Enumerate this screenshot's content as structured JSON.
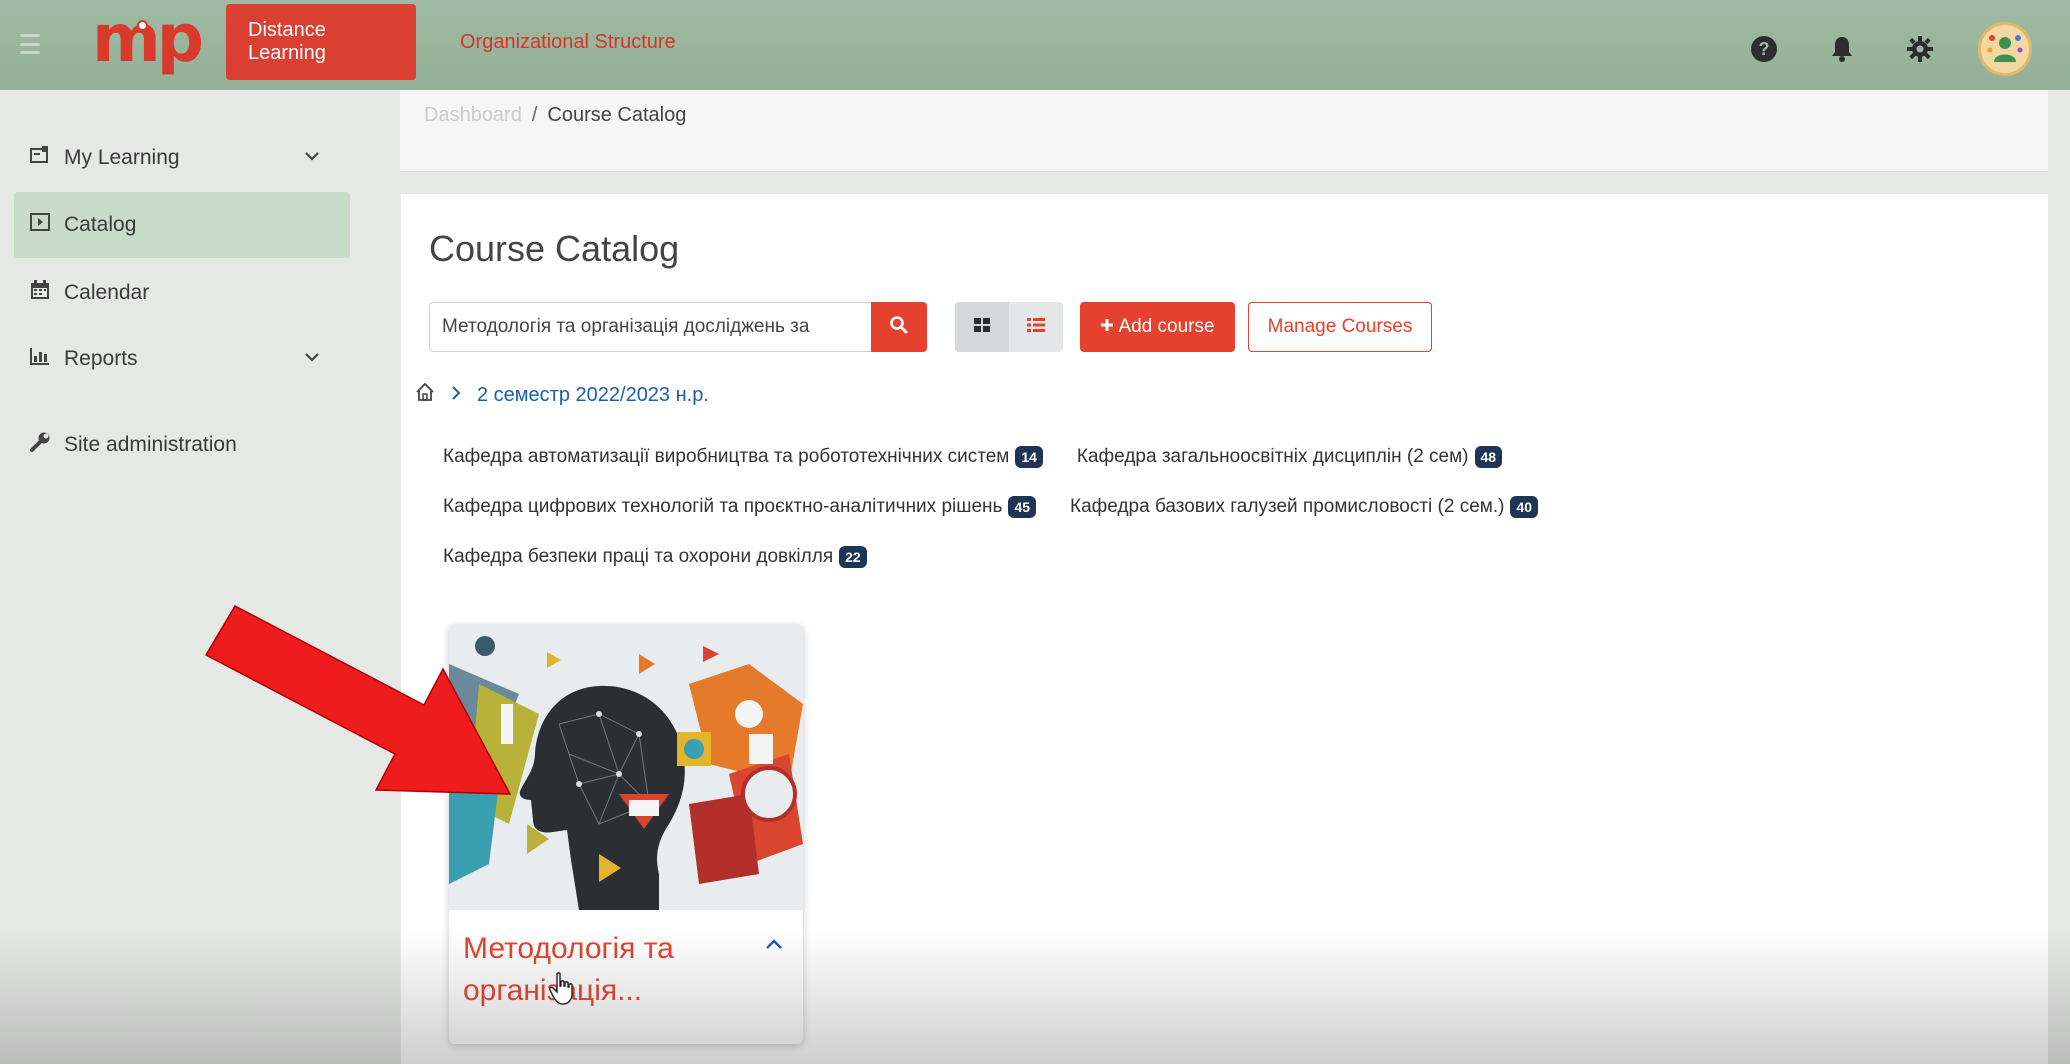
{
  "navbar": {
    "logo_text": "mp",
    "tabs": [
      {
        "label": "Distance Learning",
        "active": true
      },
      {
        "label": "Organizational Structure",
        "active": false
      }
    ],
    "icons": [
      "help-icon",
      "bell-icon",
      "gear-icon",
      "avatar"
    ]
  },
  "sidebar": {
    "items": [
      {
        "label": "My Learning",
        "icon": "my-learning-icon",
        "expandable": true
      },
      {
        "label": "Catalog",
        "icon": "catalog-icon",
        "active": true
      },
      {
        "label": "Calendar",
        "icon": "calendar-icon"
      },
      {
        "label": "Reports",
        "icon": "reports-icon",
        "expandable": true
      },
      {
        "label": "Site administration",
        "icon": "wrench-icon"
      }
    ]
  },
  "breadcrumb": {
    "home": "Dashboard",
    "separator": "/",
    "current": "Course Catalog"
  },
  "main": {
    "title": "Course Catalog",
    "search": {
      "value": "Методологія та організація досліджень за"
    },
    "add_course_label": "Add course",
    "manage_courses_label": "Manage Courses",
    "path": {
      "current": "2 семестр 2022/2023 н.р."
    },
    "categories": [
      {
        "name": "Кафедра автоматизації виробництва та робототехнічних систем",
        "count": "14"
      },
      {
        "name": "Кафедра загальноосвітніх дисциплін (2 сем)",
        "count": "48"
      },
      {
        "name": "Кафедра цифрових технологій та проєктно-аналітичних рішень",
        "count": "45"
      },
      {
        "name": "Кафедра базових галузей промисловості (2 сем.)",
        "count": "40"
      },
      {
        "name": "Кафедра безпеки праці та охорони довкілля",
        "count": "22"
      }
    ],
    "course_card": {
      "title_line1": "Методологія та",
      "title_line2": "організація..."
    }
  },
  "colors": {
    "navbar": "#9fbaa2",
    "accent": "#e4412f",
    "active_sidebar": "#c9dcca",
    "badge": "#1f3557",
    "link": "#1a5fa8",
    "arrow": "#ee1c1c"
  }
}
